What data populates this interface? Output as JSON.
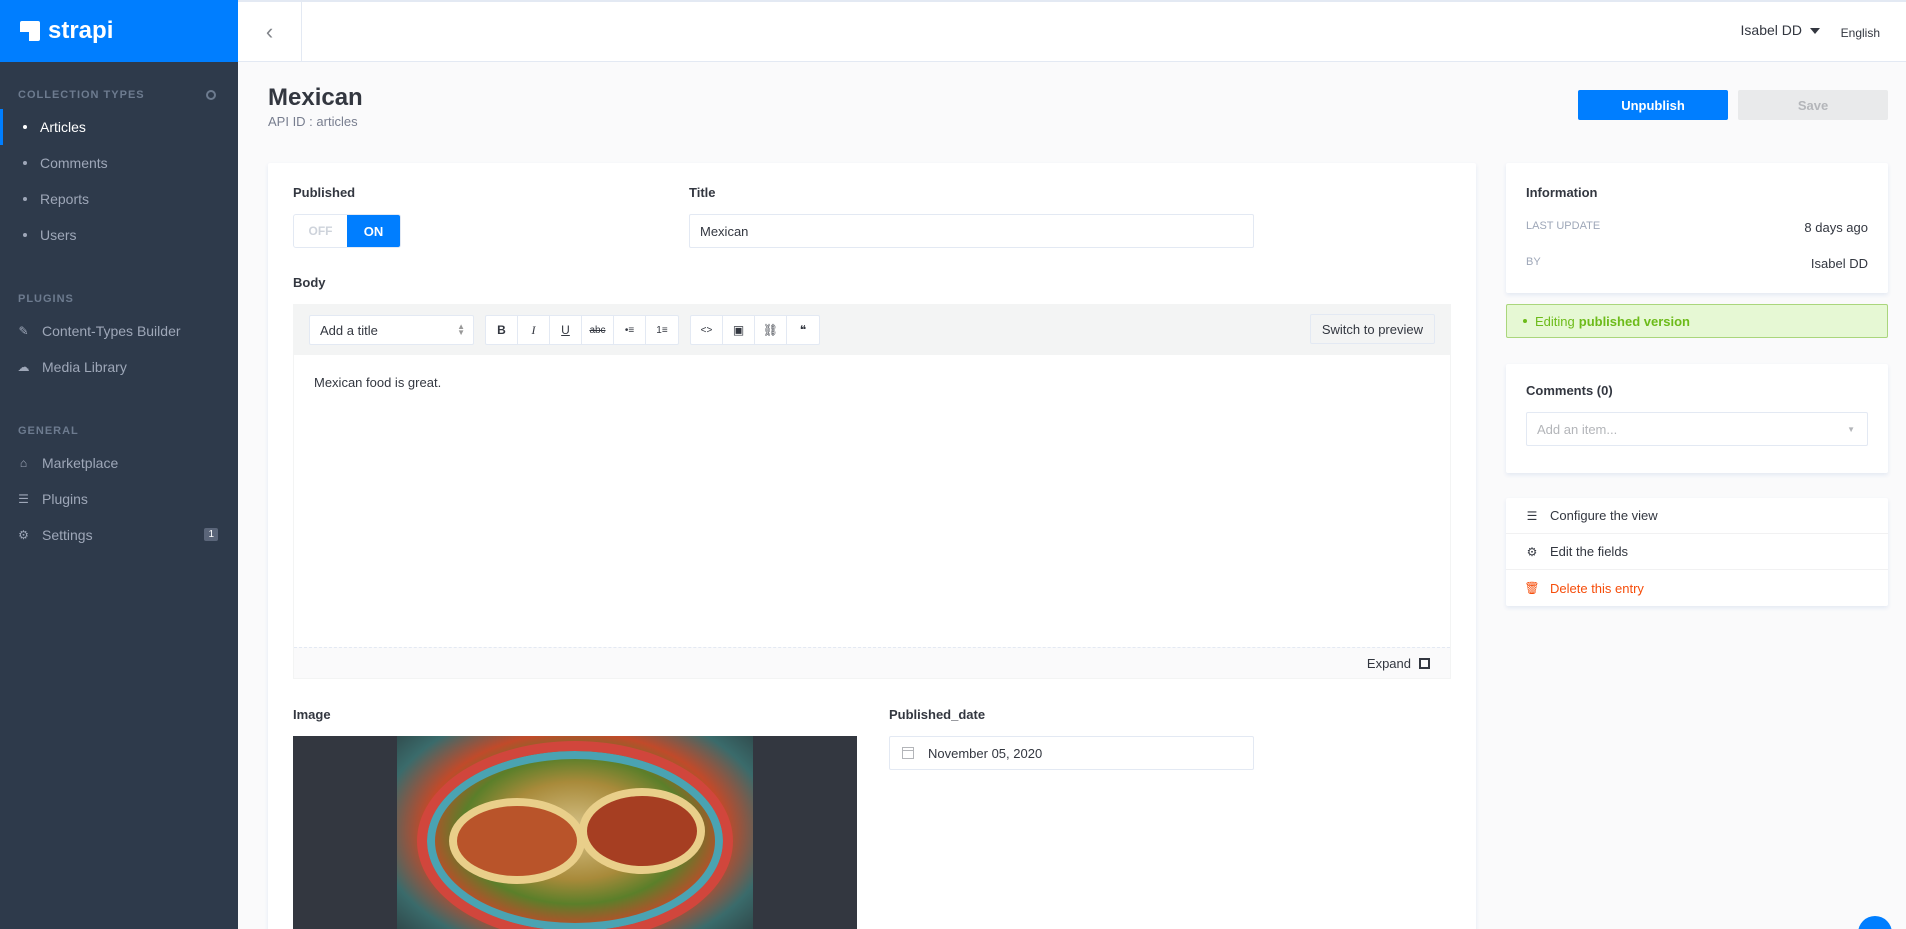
{
  "brand": {
    "name": "strapi"
  },
  "sidebar": {
    "collection_title": "COLLECTION TYPES",
    "collections": [
      {
        "label": "Articles",
        "active": true
      },
      {
        "label": "Comments"
      },
      {
        "label": "Reports"
      },
      {
        "label": "Users"
      }
    ],
    "plugins_title": "PLUGINS",
    "plugins": [
      {
        "label": "Content-Types Builder",
        "icon": "paintbrush-icon"
      },
      {
        "label": "Media Library",
        "icon": "cloud-upload-icon"
      }
    ],
    "general_title": "GENERAL",
    "general": [
      {
        "label": "Marketplace",
        "icon": "basket-icon"
      },
      {
        "label": "Plugins",
        "icon": "list-icon"
      },
      {
        "label": "Settings",
        "icon": "gear-icon",
        "badge": "1"
      }
    ]
  },
  "header": {
    "user": "Isabel DD",
    "language": "English"
  },
  "page": {
    "title": "Mexican",
    "api_id": "API ID : articles",
    "unpublish_label": "Unpublish",
    "save_label": "Save"
  },
  "form": {
    "published_label": "Published",
    "toggle_off": "OFF",
    "toggle_on": "ON",
    "title_label": "Title",
    "title_value": "Mexican",
    "body_label": "Body",
    "heading_select": "Add a title",
    "toolbar_buttons": [
      "B",
      "I",
      "U",
      "abc",
      "•≡",
      "1≡"
    ],
    "toolbar_insert": [
      "<>",
      "▣",
      "⛓",
      "❝"
    ],
    "switch_preview": "Switch to preview",
    "body_text": "Mexican food is great.",
    "expand_label": "Expand",
    "image_label": "Image",
    "date_label": "Published_date",
    "date_value": "November 05, 2020"
  },
  "info": {
    "title": "Information",
    "last_update_key": "LAST UPDATE",
    "last_update_value": "8 days ago",
    "by_key": "BY",
    "by_value": "Isabel DD"
  },
  "status": {
    "prefix": "Editing",
    "bold": "published version"
  },
  "comments": {
    "title": "Comments (0)",
    "placeholder": "Add an item..."
  },
  "actions": [
    {
      "label": "Configure the view",
      "icon": "layout-icon"
    },
    {
      "label": "Edit the fields",
      "icon": "gear-icon"
    },
    {
      "label": "Delete this entry",
      "icon": "trash-icon",
      "danger": true
    }
  ]
}
